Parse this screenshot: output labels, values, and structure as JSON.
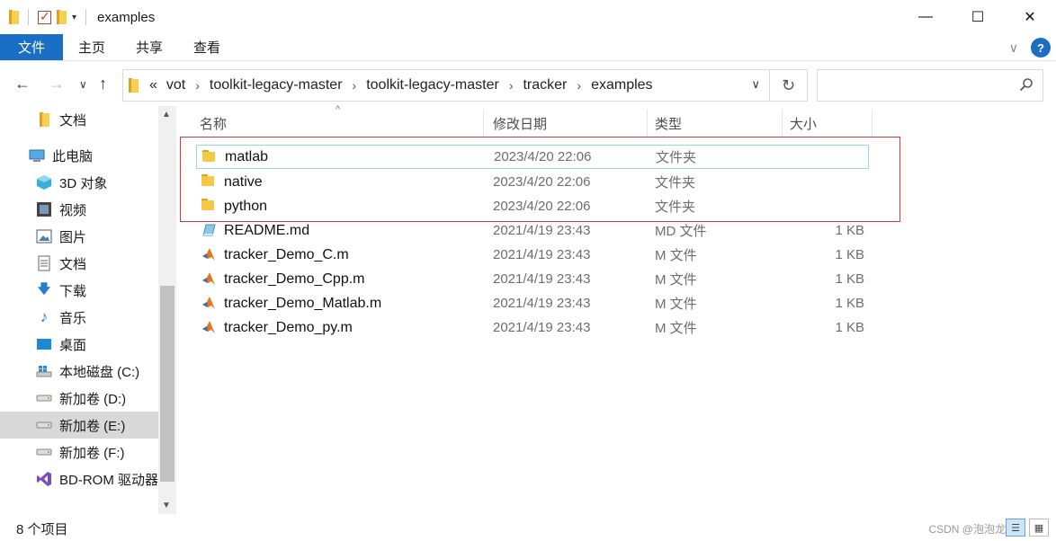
{
  "window": {
    "title": "examples"
  },
  "window_controls": {
    "minimize": "—",
    "maximize": "☐",
    "close": "✕"
  },
  "ribbon": {
    "tabs": [
      "文件",
      "主页",
      "共享",
      "查看"
    ]
  },
  "address": {
    "overflow": "«",
    "crumbs": [
      "vot",
      "toolkit-legacy-master",
      "toolkit-legacy-master",
      "tracker",
      "examples"
    ],
    "separator": "›",
    "search_placeholder": ""
  },
  "nav": {
    "items": [
      {
        "label": "文档",
        "icon": "document-folder-icon"
      },
      {
        "label": "此电脑",
        "icon": "this-pc-icon"
      },
      {
        "label": "3D 对象",
        "icon": "3d-objects-icon"
      },
      {
        "label": "视频",
        "icon": "video-icon"
      },
      {
        "label": "图片",
        "icon": "pictures-icon"
      },
      {
        "label": "文档",
        "icon": "documents-icon"
      },
      {
        "label": "下载",
        "icon": "downloads-icon"
      },
      {
        "label": "音乐",
        "icon": "music-icon"
      },
      {
        "label": "桌面",
        "icon": "desktop-icon"
      },
      {
        "label": "本地磁盘 (C:)",
        "icon": "windows-drive-icon"
      },
      {
        "label": "新加卷 (D:)",
        "icon": "drive-icon"
      },
      {
        "label": "新加卷 (E:)",
        "icon": "drive-icon",
        "selected": true
      },
      {
        "label": "新加卷 (F:)",
        "icon": "drive-icon"
      },
      {
        "label": "BD-ROM 驱动器",
        "icon": "visual-studio-icon"
      }
    ]
  },
  "columns": {
    "name": "名称",
    "date": "修改日期",
    "type": "类型",
    "size": "大小"
  },
  "files": [
    {
      "name": "matlab",
      "date": "2023/4/20 22:06",
      "type": "文件夹",
      "size": "",
      "icon": "folder-icon"
    },
    {
      "name": "native",
      "date": "2023/4/20 22:06",
      "type": "文件夹",
      "size": "",
      "icon": "folder-icon"
    },
    {
      "name": "python",
      "date": "2023/4/20 22:06",
      "type": "文件夹",
      "size": "",
      "icon": "folder-icon"
    },
    {
      "name": "README.md",
      "date": "2021/4/19 23:43",
      "type": "MD 文件",
      "size": "1 KB",
      "icon": "markdown-file-icon"
    },
    {
      "name": "tracker_Demo_C.m",
      "date": "2021/4/19 23:43",
      "type": "M 文件",
      "size": "1 KB",
      "icon": "matlab-file-icon"
    },
    {
      "name": "tracker_Demo_Cpp.m",
      "date": "2021/4/19 23:43",
      "type": "M 文件",
      "size": "1 KB",
      "icon": "matlab-file-icon"
    },
    {
      "name": "tracker_Demo_Matlab.m",
      "date": "2021/4/19 23:43",
      "type": "M 文件",
      "size": "1 KB",
      "icon": "matlab-file-icon"
    },
    {
      "name": "tracker_Demo_py.m",
      "date": "2021/4/19 23:43",
      "type": "M 文件",
      "size": "1 KB",
      "icon": "matlab-file-icon"
    }
  ],
  "status": {
    "item_count": "8 个项目",
    "watermark": "CSDN @泡泡龙"
  },
  "colors": {
    "accent": "#1a6fc4",
    "folder": "#f5c945",
    "highlight_box": "#d9363e",
    "selection_border": "#99d1ff"
  }
}
